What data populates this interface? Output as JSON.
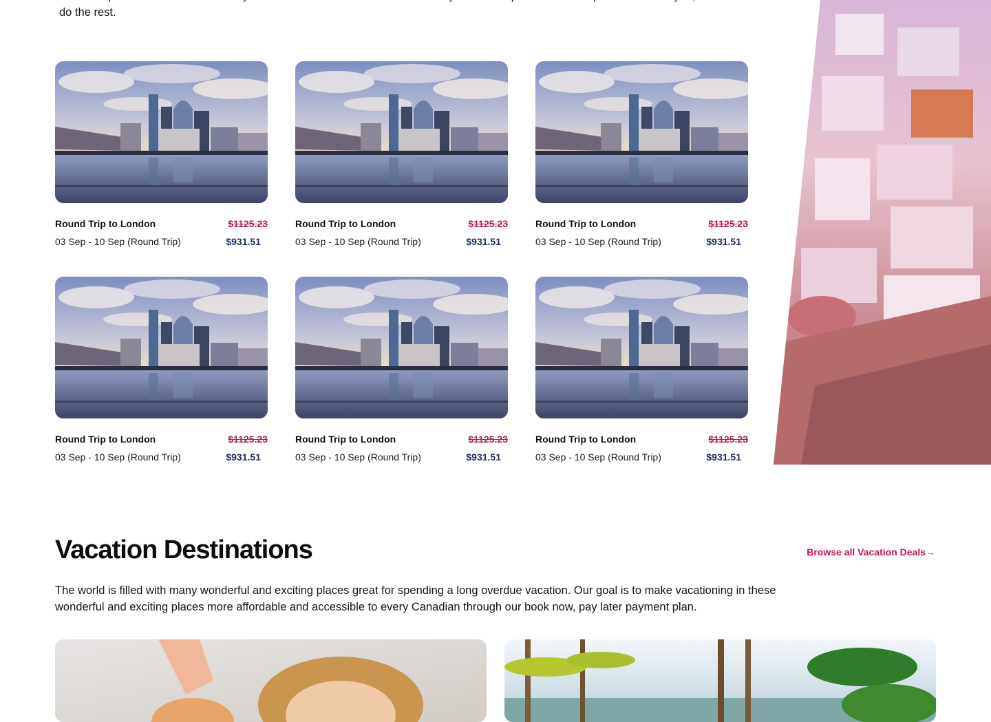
{
  "intro": {
    "text": "Round Trip deals that are tailored to your wants and needs as a traveller. You just have to pick a Round Trip that works for you, and we’ll do the rest."
  },
  "deals": [
    {
      "title": "Round Trip to London",
      "dates": "03 Sep - 10 Sep (Round Trip)",
      "old_price": "$1125.23",
      "new_price": "$931.51"
    },
    {
      "title": "Round Trip to London",
      "dates": "03 Sep - 10 Sep (Round Trip)",
      "old_price": "$1125.23",
      "new_price": "$931.51"
    },
    {
      "title": "Round Trip to London",
      "dates": "03 Sep - 10 Sep (Round Trip)",
      "old_price": "$1125.23",
      "new_price": "$931.51"
    },
    {
      "title": "Round Trip to London",
      "dates": "03 Sep - 10 Sep (Round Trip)",
      "old_price": "$1125.23",
      "new_price": "$931.51"
    },
    {
      "title": "Round Trip to London",
      "dates": "03 Sep - 10 Sep (Round Trip)",
      "old_price": "$1125.23",
      "new_price": "$931.51"
    },
    {
      "title": "Round Trip to London",
      "dates": "03 Sep - 10 Sep (Round Trip)",
      "old_price": "$1125.23",
      "new_price": "$931.51"
    }
  ],
  "vacation": {
    "title": "Vacation Destinations",
    "browse_label": "Browse all Vacation Deals→",
    "description": "The world is filled with many wonderful and exciting places great for spending a long overdue vacation. Our goal is to make vacationing in these wonderful and exciting places more affordable and accessible to every Canadian through our book now, pay later payment plan."
  },
  "colors": {
    "old_price": "#b01e5a",
    "new_price": "#1f2a5c",
    "link": "#c0164f"
  }
}
